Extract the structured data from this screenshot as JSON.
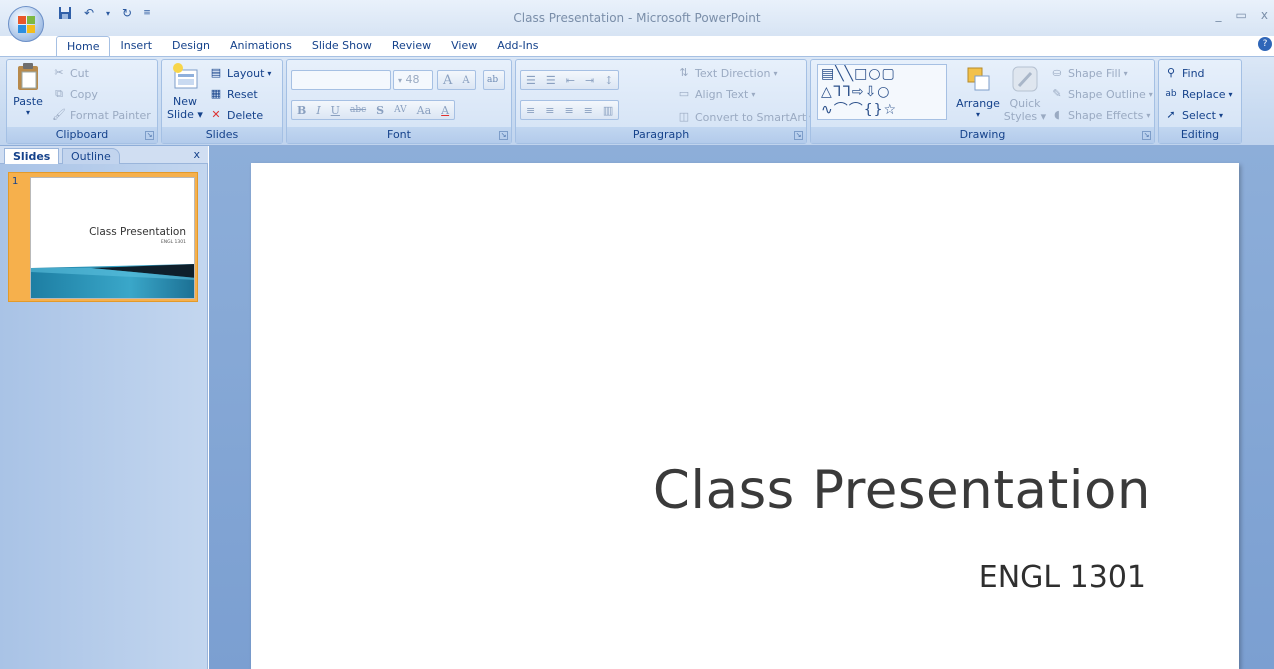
{
  "window": {
    "title": "Class Presentation - Microsoft PowerPoint",
    "controls": [
      "_",
      "▭",
      "x"
    ]
  },
  "ribbon_tabs": [
    {
      "label": "Home",
      "active": true
    },
    {
      "label": "Insert"
    },
    {
      "label": "Design"
    },
    {
      "label": "Animations"
    },
    {
      "label": "Slide Show"
    },
    {
      "label": "Review"
    },
    {
      "label": "View"
    },
    {
      "label": "Add-Ins"
    }
  ],
  "clipboard": {
    "label": "Clipboard",
    "paste": "Paste",
    "cut": "Cut",
    "copy": "Copy",
    "format_painter": "Format Painter"
  },
  "slides_group": {
    "label": "Slides",
    "new_slide_line1": "New",
    "new_slide_line2": "Slide",
    "layout": "Layout",
    "reset": "Reset",
    "delete": "Delete"
  },
  "font": {
    "label": "Font",
    "font_size": "48",
    "bold": "B",
    "italic": "I",
    "underline": "U",
    "strike": "abc",
    "shadow": "S",
    "spacing": "AV",
    "case": "Aa",
    "color": "A",
    "grow": "A",
    "shrink": "A"
  },
  "paragraph": {
    "label": "Paragraph",
    "text_direction": "Text Direction",
    "align_text": "Align Text",
    "convert_smartart": "Convert to SmartArt"
  },
  "drawing": {
    "label": "Drawing",
    "arrange": "Arrange",
    "quick_styles_line1": "Quick",
    "quick_styles_line2": "Styles",
    "shape_fill": "Shape Fill",
    "shape_outline": "Shape Outline",
    "shape_effects": "Shape Effects"
  },
  "editing": {
    "label": "Editing",
    "find": "Find",
    "replace": "Replace",
    "select": "Select"
  },
  "panel": {
    "tab_slides": "Slides",
    "tab_outline": "Outline",
    "close": "x",
    "slide_number": "1",
    "thumb_title": "Class Presentation",
    "thumb_subtitle": "ENGL 1301"
  },
  "slide": {
    "title": "Class Presentation",
    "subtitle": "ENGL 1301"
  }
}
